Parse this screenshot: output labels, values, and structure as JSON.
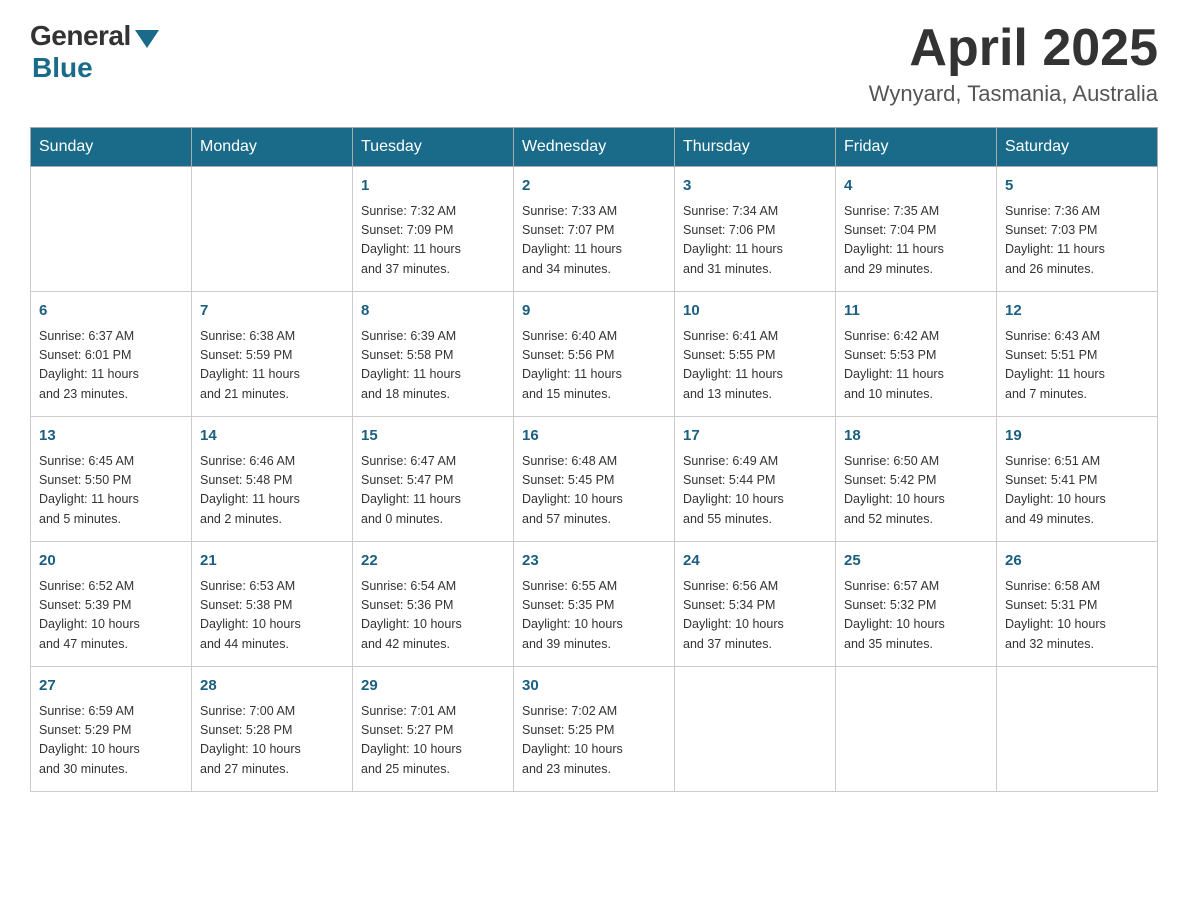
{
  "header": {
    "logo_general": "General",
    "logo_blue": "Blue",
    "month_year": "April 2025",
    "location": "Wynyard, Tasmania, Australia"
  },
  "days_of_week": [
    "Sunday",
    "Monday",
    "Tuesday",
    "Wednesday",
    "Thursday",
    "Friday",
    "Saturday"
  ],
  "weeks": [
    [
      {
        "num": "",
        "info": ""
      },
      {
        "num": "",
        "info": ""
      },
      {
        "num": "1",
        "info": "Sunrise: 7:32 AM\nSunset: 7:09 PM\nDaylight: 11 hours\nand 37 minutes."
      },
      {
        "num": "2",
        "info": "Sunrise: 7:33 AM\nSunset: 7:07 PM\nDaylight: 11 hours\nand 34 minutes."
      },
      {
        "num": "3",
        "info": "Sunrise: 7:34 AM\nSunset: 7:06 PM\nDaylight: 11 hours\nand 31 minutes."
      },
      {
        "num": "4",
        "info": "Sunrise: 7:35 AM\nSunset: 7:04 PM\nDaylight: 11 hours\nand 29 minutes."
      },
      {
        "num": "5",
        "info": "Sunrise: 7:36 AM\nSunset: 7:03 PM\nDaylight: 11 hours\nand 26 minutes."
      }
    ],
    [
      {
        "num": "6",
        "info": "Sunrise: 6:37 AM\nSunset: 6:01 PM\nDaylight: 11 hours\nand 23 minutes."
      },
      {
        "num": "7",
        "info": "Sunrise: 6:38 AM\nSunset: 5:59 PM\nDaylight: 11 hours\nand 21 minutes."
      },
      {
        "num": "8",
        "info": "Sunrise: 6:39 AM\nSunset: 5:58 PM\nDaylight: 11 hours\nand 18 minutes."
      },
      {
        "num": "9",
        "info": "Sunrise: 6:40 AM\nSunset: 5:56 PM\nDaylight: 11 hours\nand 15 minutes."
      },
      {
        "num": "10",
        "info": "Sunrise: 6:41 AM\nSunset: 5:55 PM\nDaylight: 11 hours\nand 13 minutes."
      },
      {
        "num": "11",
        "info": "Sunrise: 6:42 AM\nSunset: 5:53 PM\nDaylight: 11 hours\nand 10 minutes."
      },
      {
        "num": "12",
        "info": "Sunrise: 6:43 AM\nSunset: 5:51 PM\nDaylight: 11 hours\nand 7 minutes."
      }
    ],
    [
      {
        "num": "13",
        "info": "Sunrise: 6:45 AM\nSunset: 5:50 PM\nDaylight: 11 hours\nand 5 minutes."
      },
      {
        "num": "14",
        "info": "Sunrise: 6:46 AM\nSunset: 5:48 PM\nDaylight: 11 hours\nand 2 minutes."
      },
      {
        "num": "15",
        "info": "Sunrise: 6:47 AM\nSunset: 5:47 PM\nDaylight: 11 hours\nand 0 minutes."
      },
      {
        "num": "16",
        "info": "Sunrise: 6:48 AM\nSunset: 5:45 PM\nDaylight: 10 hours\nand 57 minutes."
      },
      {
        "num": "17",
        "info": "Sunrise: 6:49 AM\nSunset: 5:44 PM\nDaylight: 10 hours\nand 55 minutes."
      },
      {
        "num": "18",
        "info": "Sunrise: 6:50 AM\nSunset: 5:42 PM\nDaylight: 10 hours\nand 52 minutes."
      },
      {
        "num": "19",
        "info": "Sunrise: 6:51 AM\nSunset: 5:41 PM\nDaylight: 10 hours\nand 49 minutes."
      }
    ],
    [
      {
        "num": "20",
        "info": "Sunrise: 6:52 AM\nSunset: 5:39 PM\nDaylight: 10 hours\nand 47 minutes."
      },
      {
        "num": "21",
        "info": "Sunrise: 6:53 AM\nSunset: 5:38 PM\nDaylight: 10 hours\nand 44 minutes."
      },
      {
        "num": "22",
        "info": "Sunrise: 6:54 AM\nSunset: 5:36 PM\nDaylight: 10 hours\nand 42 minutes."
      },
      {
        "num": "23",
        "info": "Sunrise: 6:55 AM\nSunset: 5:35 PM\nDaylight: 10 hours\nand 39 minutes."
      },
      {
        "num": "24",
        "info": "Sunrise: 6:56 AM\nSunset: 5:34 PM\nDaylight: 10 hours\nand 37 minutes."
      },
      {
        "num": "25",
        "info": "Sunrise: 6:57 AM\nSunset: 5:32 PM\nDaylight: 10 hours\nand 35 minutes."
      },
      {
        "num": "26",
        "info": "Sunrise: 6:58 AM\nSunset: 5:31 PM\nDaylight: 10 hours\nand 32 minutes."
      }
    ],
    [
      {
        "num": "27",
        "info": "Sunrise: 6:59 AM\nSunset: 5:29 PM\nDaylight: 10 hours\nand 30 minutes."
      },
      {
        "num": "28",
        "info": "Sunrise: 7:00 AM\nSunset: 5:28 PM\nDaylight: 10 hours\nand 27 minutes."
      },
      {
        "num": "29",
        "info": "Sunrise: 7:01 AM\nSunset: 5:27 PM\nDaylight: 10 hours\nand 25 minutes."
      },
      {
        "num": "30",
        "info": "Sunrise: 7:02 AM\nSunset: 5:25 PM\nDaylight: 10 hours\nand 23 minutes."
      },
      {
        "num": "",
        "info": ""
      },
      {
        "num": "",
        "info": ""
      },
      {
        "num": "",
        "info": ""
      }
    ]
  ]
}
